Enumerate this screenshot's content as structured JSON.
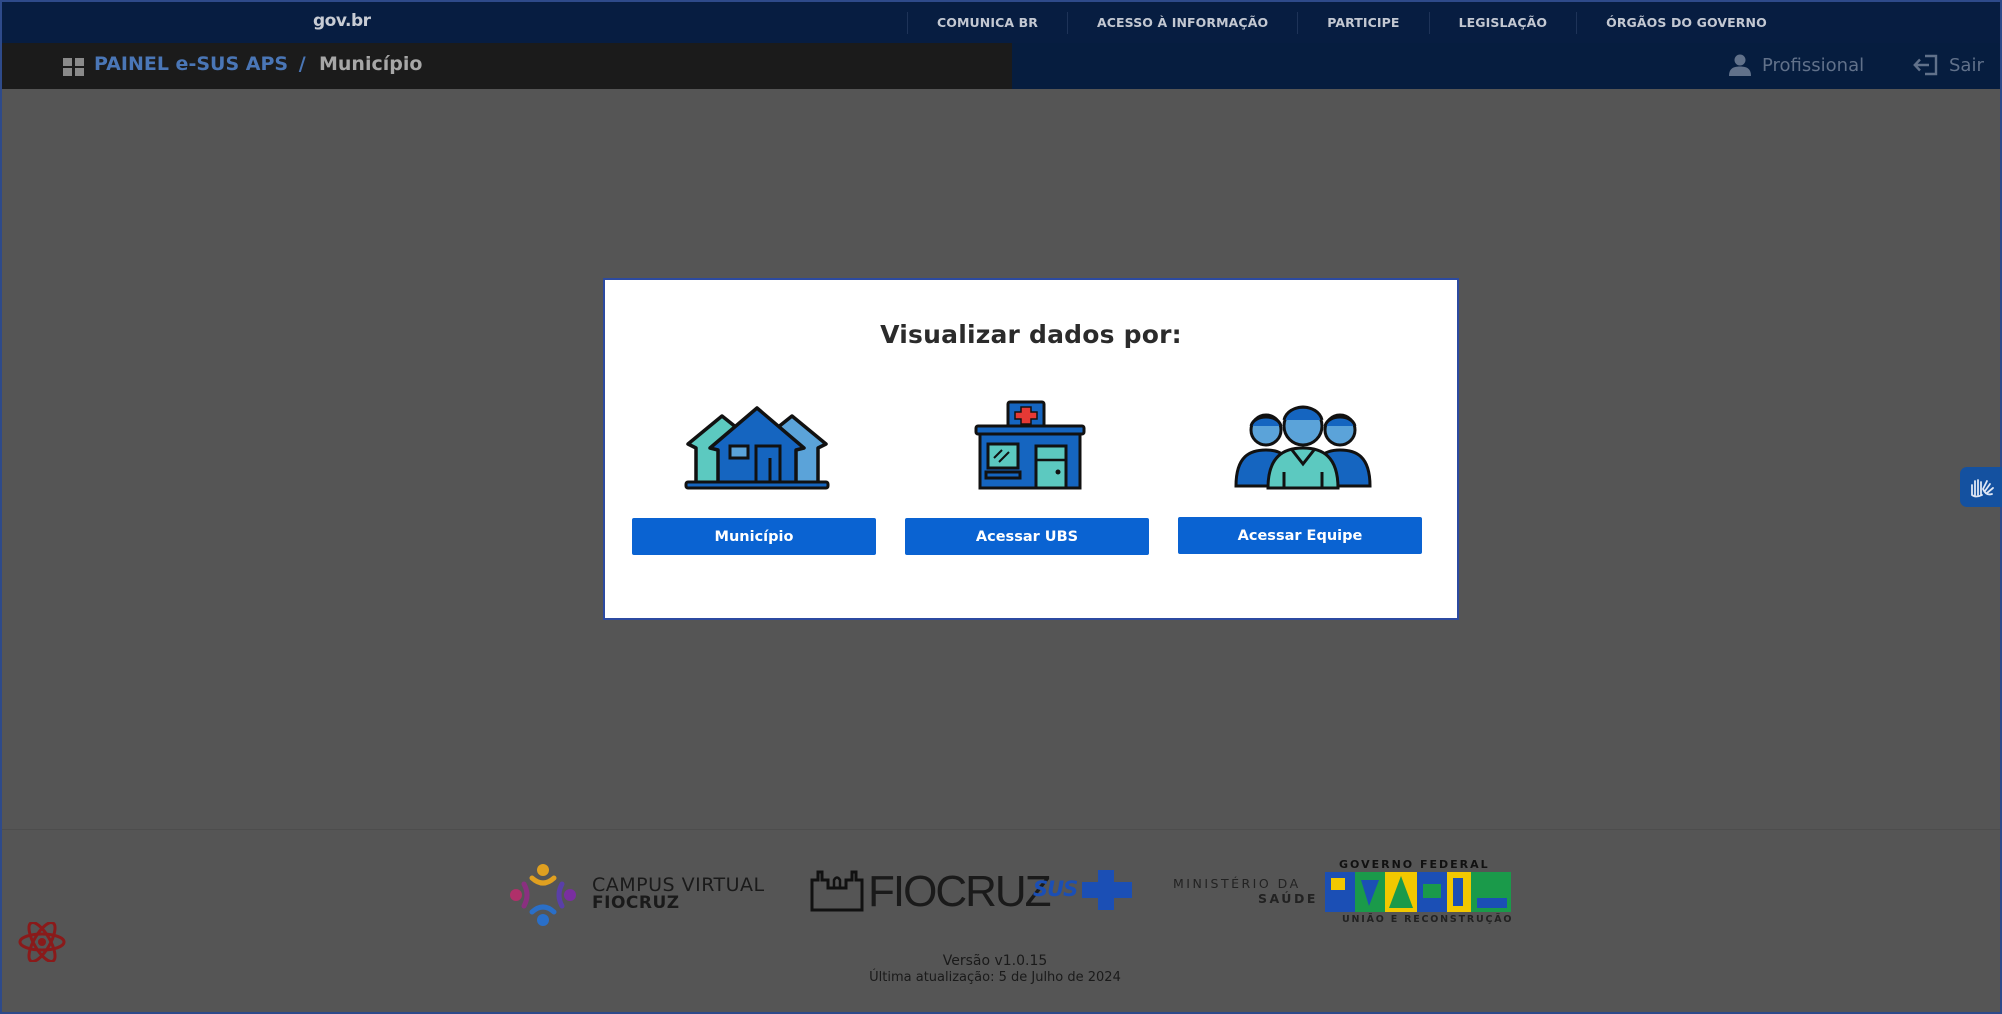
{
  "govbar": {
    "logo": "gov.br",
    "links": [
      "COMUNICA BR",
      "ACESSO À INFORMAÇÃO",
      "PARTICIPE",
      "LEGISLAÇÃO",
      "ÓRGÃOS DO GOVERNO"
    ]
  },
  "header": {
    "brand": "PAINEL e-SUS APS",
    "separator": "/",
    "current": "Município",
    "profile_label": "Profissional",
    "logout_label": "Sair"
  },
  "modal": {
    "title": "Visualizar dados por:",
    "options": [
      {
        "label": "Município",
        "icon": "houses-icon"
      },
      {
        "label": "Acessar UBS",
        "icon": "clinic-icon"
      },
      {
        "label": "Acessar Equipe",
        "icon": "team-icon"
      }
    ]
  },
  "footer": {
    "campus_line1": "CAMPUS VIRTUAL",
    "campus_line2": "FIOCRUZ",
    "fiocruz": "FIOCRUZ",
    "sus": "SUS",
    "ministerio_line1": "MINISTÉRIO DA",
    "ministerio_line2": "SAÚDE",
    "gov_federal": "GOVERNO FEDERAL",
    "brasil": "BRASIL",
    "uniao": "UNIÃO E RECONSTRUÇÃO",
    "version": "Versão v1.0.15",
    "last_update": "Última atualização: 5 de Julho de 2024"
  },
  "colors": {
    "overlay": "#555555",
    "govbar": "#071d41",
    "primary_button": "#0a63d2",
    "brand_text": "#4a76b6"
  }
}
